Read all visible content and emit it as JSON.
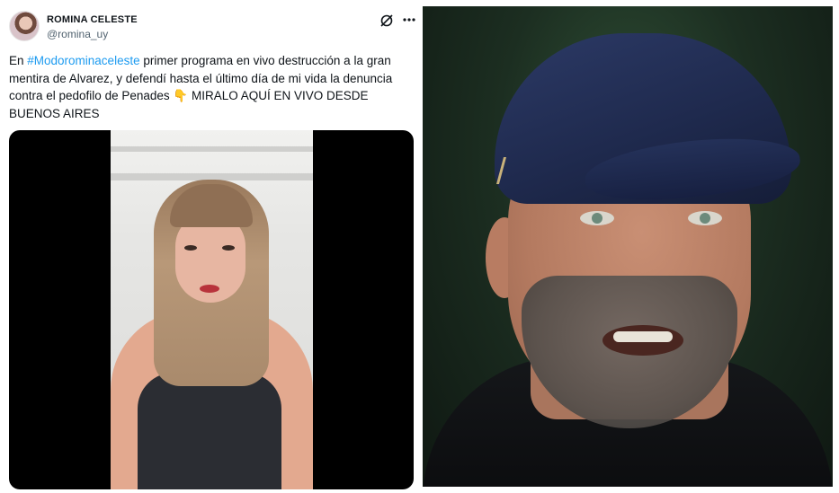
{
  "tweet": {
    "display_name": "ROMINA CELESTE",
    "handle": "@romina_uy",
    "text_prefix": "En ",
    "hashtag": "#Modorominaceleste",
    "text_body": " primer programa en vivo destrucción a la gran mentira de Alvarez, y defendí hasta el último día de mi vida la denuncia contra el pedofilo de Penades ",
    "emoji": "👇",
    "text_suffix": " MIRALO AQUÍ EN VIVO DESDE BUENOS AIRES",
    "icons": [
      "grok-icon",
      "more-icon"
    ],
    "colors": {
      "hashtag": "#1d9bf0",
      "text": "#0f1419",
      "handle": "#536471"
    }
  }
}
